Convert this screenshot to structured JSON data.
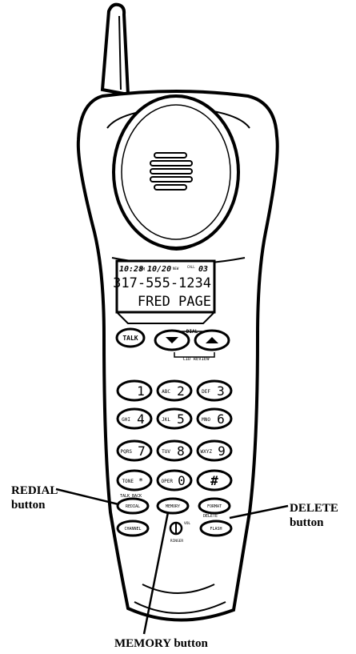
{
  "display": {
    "status": {
      "time": "10:28",
      "am_pm": "PM",
      "date": "10/20",
      "new_flag": "NEW",
      "call_label": "CALL",
      "call_no": "03"
    },
    "number": "317-555-1234",
    "name": "FRED PAGE"
  },
  "labels": {
    "dial": "DIAL",
    "cid_review": "CID REVIEW",
    "talk_back": "TALK BACK",
    "delete": "DELETE",
    "ringer": "RINGER",
    "vol": "VOL"
  },
  "keys": {
    "talk": "TALK",
    "k1": {
      "letters": "",
      "digit": "1"
    },
    "k2": {
      "letters": "ABC",
      "digit": "2"
    },
    "k3": {
      "letters": "DEF",
      "digit": "3"
    },
    "k4": {
      "letters": "GHI",
      "digit": "4"
    },
    "k5": {
      "letters": "JKL",
      "digit": "5"
    },
    "k6": {
      "letters": "MNO",
      "digit": "6"
    },
    "k7": {
      "letters": "PQRS",
      "digit": "7"
    },
    "k8": {
      "letters": "TUV",
      "digit": "8"
    },
    "k9": {
      "letters": "WXYZ",
      "digit": "9"
    },
    "kstar": {
      "letters": "TONE",
      "digit": "*"
    },
    "k0": {
      "letters": "OPER",
      "digit": "0"
    },
    "khash": {
      "letters": "",
      "digit": "#"
    },
    "redial": "REDIAL",
    "memory": "MEMORY",
    "format": "FORMAT",
    "channel": "CHANNEL",
    "flash": "FLASH"
  },
  "callouts": {
    "redial": {
      "line1": "REDIAL",
      "line2": "button"
    },
    "delete": {
      "line1": "DELETE",
      "line2": "button"
    },
    "memory": "MEMORY button"
  }
}
